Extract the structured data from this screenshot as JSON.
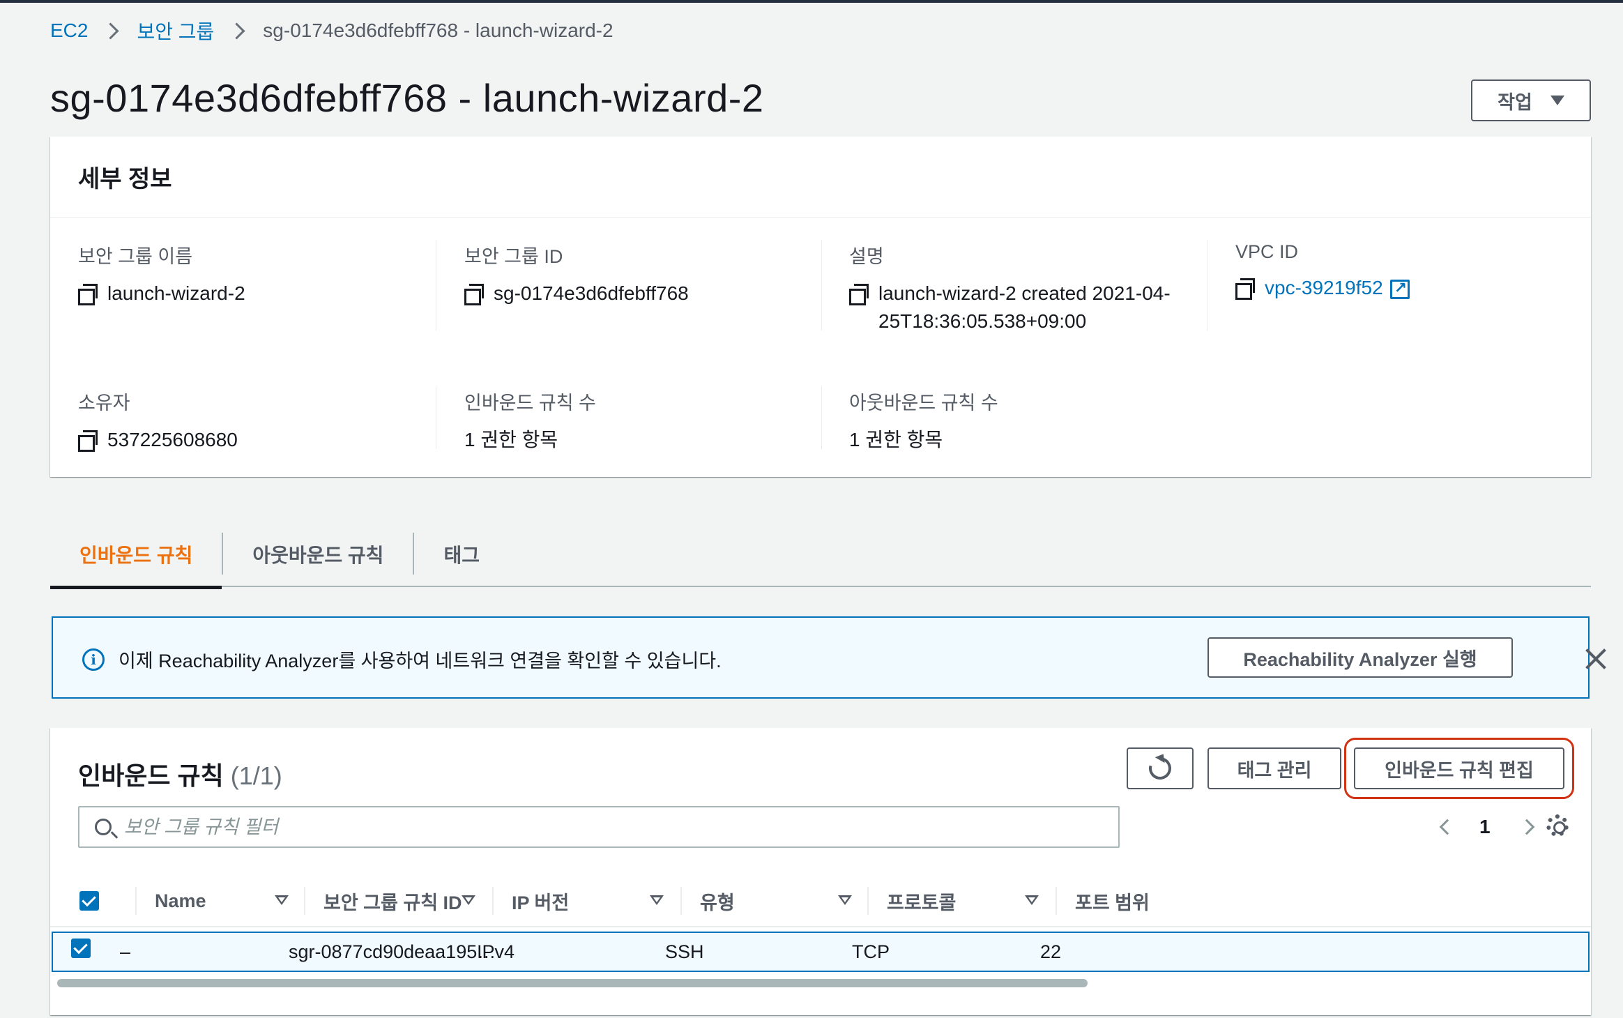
{
  "breadcrumb": {
    "items": [
      "EC2",
      "보안 그룹"
    ],
    "current": "sg-0174e3d6dfebff768 - launch-wizard-2"
  },
  "page": {
    "title": "sg-0174e3d6dfebff768 - launch-wizard-2",
    "actions_label": "작업"
  },
  "details": {
    "heading": "세부 정보",
    "fields": {
      "sg_name": {
        "label": "보안 그룹 이름",
        "value": "launch-wizard-2"
      },
      "sg_id": {
        "label": "보안 그룹 ID",
        "value": "sg-0174e3d6dfebff768"
      },
      "description": {
        "label": "설명",
        "value": "launch-wizard-2 created 2021-04-25T18:36:05.538+09:00"
      },
      "vpc_id": {
        "label": "VPC ID",
        "value": "vpc-39219f52"
      },
      "owner": {
        "label": "소유자",
        "value": "537225608680"
      },
      "inbound_count": {
        "label": "인바운드 규칙 수",
        "value": "1 권한 항목"
      },
      "outbound_count": {
        "label": "아웃바운드 규칙 수",
        "value": "1 권한 항목"
      }
    }
  },
  "tabs": [
    {
      "label": "인바운드 규칙",
      "active": true
    },
    {
      "label": "아웃바운드 규칙",
      "active": false
    },
    {
      "label": "태그",
      "active": false
    }
  ],
  "flash": {
    "message": "이제 Reachability Analyzer를 사용하여 네트워크 연결을 확인할 수 있습니다.",
    "button_label": "Reachability Analyzer 실행"
  },
  "rules": {
    "title": "인바운드 규칙",
    "count": "(1/1)",
    "tag_manage_label": "태그 관리",
    "edit_label": "인바운드 규칙 편집",
    "filter_placeholder": "보안 그룹 규칙 필터",
    "page_number": "1",
    "columns": [
      "Name",
      "보안 그룹 규칙 ID",
      "IP 버전",
      "유형",
      "프로토콜",
      "포트 범위"
    ],
    "rows": [
      {
        "name": "–",
        "rule_id": "sgr-0877cd90deaa195…",
        "ip_version": "IPv4",
        "type": "SSH",
        "protocol": "TCP",
        "port_range": "22"
      }
    ]
  },
  "colors": {
    "link": "#0073bb",
    "active_tab": "#ec7211",
    "highlight": "#d13212",
    "info_bg": "#f1faff"
  }
}
